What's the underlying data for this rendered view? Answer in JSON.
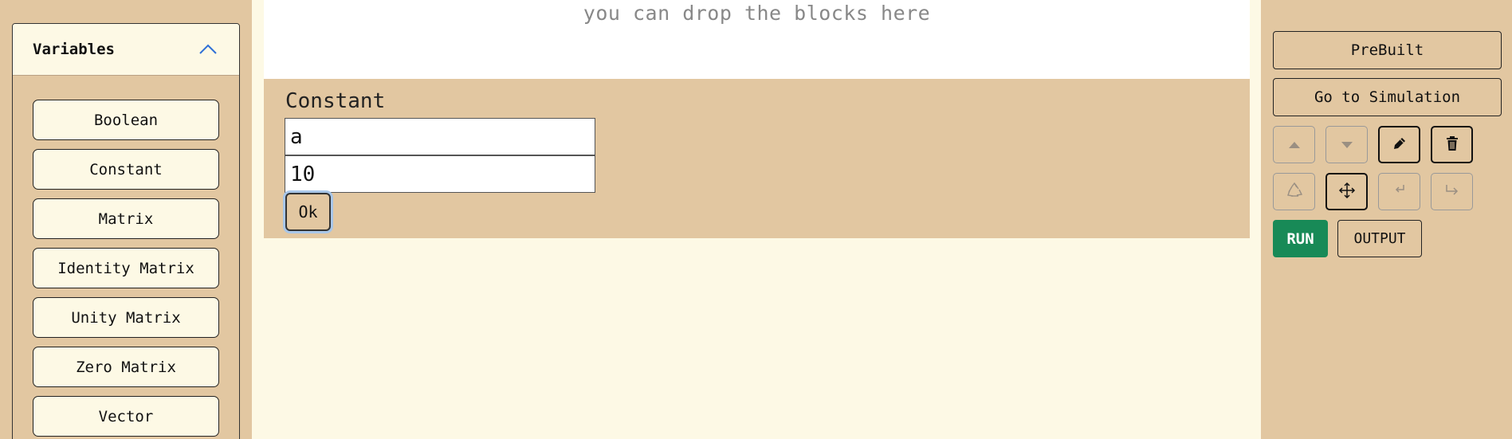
{
  "sidebar": {
    "section_title": "Variables",
    "section_icon": "chevron-up-icon",
    "items": [
      {
        "label": "Boolean"
      },
      {
        "label": "Constant"
      },
      {
        "label": "Matrix"
      },
      {
        "label": "Identity Matrix"
      },
      {
        "label": "Unity Matrix"
      },
      {
        "label": "Zero Matrix"
      },
      {
        "label": "Vector"
      }
    ]
  },
  "canvas": {
    "drop_hint": "you can drop the blocks here",
    "constant_block": {
      "title": "Constant",
      "name_value": "a",
      "value_value": "10",
      "ok_label": "Ok"
    }
  },
  "toolbar": {
    "prebuilt_label": "PreBuilt",
    "go_to_simulation_label": "Go to Simulation",
    "tools": [
      {
        "icon": "arrow-up-icon",
        "active": false
      },
      {
        "icon": "arrow-down-icon",
        "active": false
      },
      {
        "icon": "pencil-icon",
        "active": true
      },
      {
        "icon": "trash-icon",
        "active": true
      },
      {
        "icon": "recycle-icon",
        "active": false
      },
      {
        "icon": "move-icon",
        "active": true
      },
      {
        "icon": "corner-down-left-icon",
        "active": false
      },
      {
        "icon": "corner-up-right-icon",
        "active": false
      }
    ],
    "run_label": "RUN",
    "output_label": "OUTPUT"
  },
  "colors": {
    "panel_bg": "#e2c7a1",
    "canvas_bg": "#fdf9e5",
    "run_green": "#188a57",
    "accent_blue": "#2f6fd6"
  }
}
